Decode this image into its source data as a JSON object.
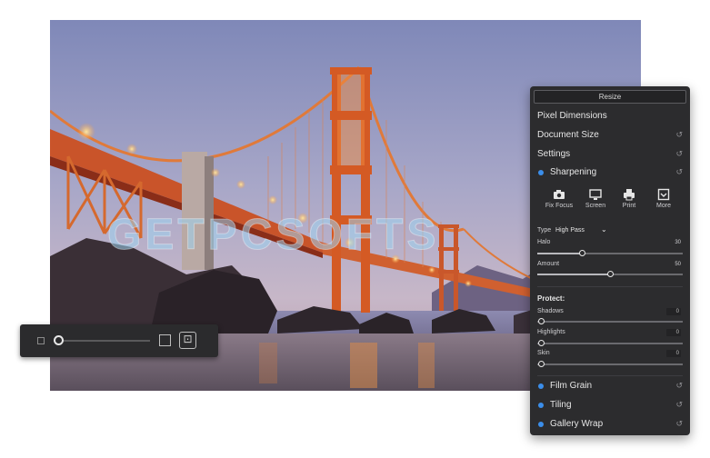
{
  "panel": {
    "resize_button": "Resize",
    "sections": {
      "pixel_dimensions": "Pixel Dimensions",
      "document_size": "Document Size",
      "settings": "Settings",
      "sharpening": "Sharpening",
      "film_grain": "Film Grain",
      "tiling": "Tiling",
      "gallery_wrap": "Gallery Wrap"
    },
    "reset_icon": "↺",
    "presets": [
      {
        "label": "Fix Focus",
        "icon": "camera-icon"
      },
      {
        "label": "Screen",
        "icon": "monitor-icon"
      },
      {
        "label": "Print",
        "icon": "printer-icon"
      },
      {
        "label": "More",
        "icon": "more-icon"
      }
    ],
    "type_label": "Type",
    "type_value": "High Pass",
    "halo": {
      "label": "Halo",
      "value": "30"
    },
    "amount": {
      "label": "Amount",
      "value": "50"
    },
    "protect_label": "Protect:",
    "shadows": {
      "label": "Shadows",
      "value": "0"
    },
    "highlights": {
      "label": "Highlights",
      "value": "0"
    },
    "skin": {
      "label": "Skin",
      "value": "0"
    },
    "accent_color": "#3b8eea"
  },
  "watermark": {
    "text": "GETPCSOFTS"
  },
  "mini_toolbar": {
    "fit_glyph": "⊡"
  }
}
